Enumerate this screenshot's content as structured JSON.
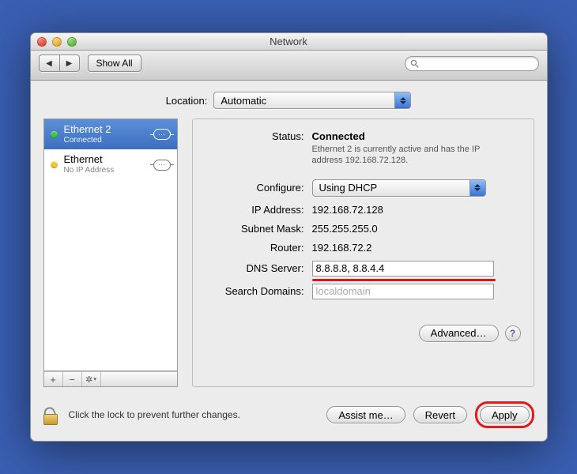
{
  "window": {
    "title": "Network"
  },
  "toolbar": {
    "showAll": "Show All"
  },
  "location": {
    "label": "Location:",
    "value": "Automatic"
  },
  "sidebar": {
    "items": [
      {
        "name": "Ethernet 2",
        "sub": "Connected",
        "statusColor": "green",
        "selected": true
      },
      {
        "name": "Ethernet",
        "sub": "No IP Address",
        "statusColor": "yellow",
        "selected": false
      }
    ]
  },
  "detail": {
    "statusLabel": "Status:",
    "statusValue": "Connected",
    "statusDesc": "Ethernet 2 is currently active and has the IP address 192.168.72.128.",
    "configureLabel": "Configure:",
    "configureValue": "Using DHCP",
    "ipLabel": "IP Address:",
    "ipValue": "192.168.72.128",
    "subnetLabel": "Subnet Mask:",
    "subnetValue": "255.255.255.0",
    "routerLabel": "Router:",
    "routerValue": "192.168.72.2",
    "dnsLabel": "DNS Server:",
    "dnsValue": "8.8.8.8, 8.8.4.4",
    "searchDomainsLabel": "Search Domains:",
    "searchDomainsPlaceholder": "localdomain",
    "advanced": "Advanced…",
    "help": "?"
  },
  "footer": {
    "lockText": "Click the lock to prevent further changes.",
    "assist": "Assist me…",
    "revert": "Revert",
    "apply": "Apply"
  }
}
